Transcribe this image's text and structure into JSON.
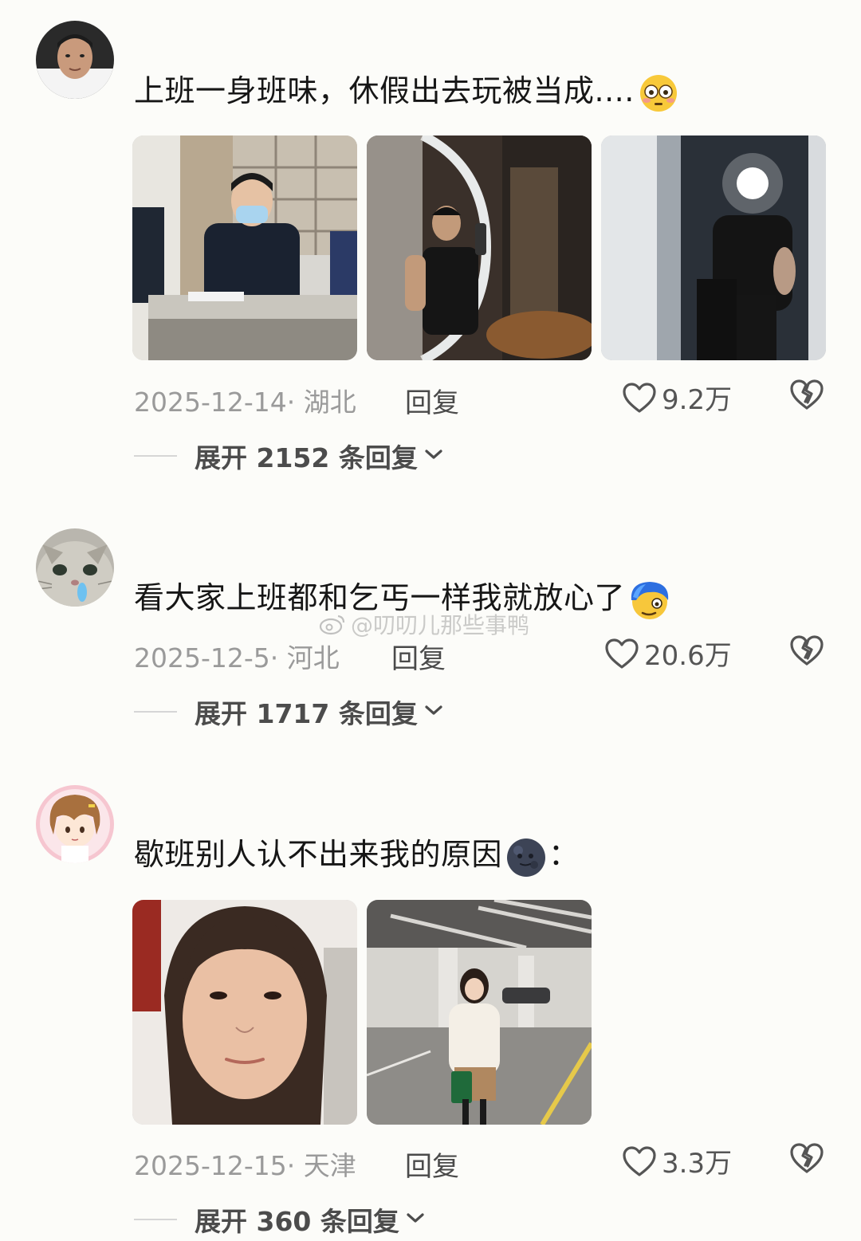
{
  "comments": [
    {
      "text": "上班一身班味，休假出去玩被当成....",
      "emoji": "flushed-face-emoji",
      "date": "2025-12-14·",
      "location": "湖北",
      "reply_label": "回复",
      "likes": "9.2万",
      "expand_label": "展开 2152 条回复"
    },
    {
      "text": "看大家上班都和乞丐一样我就放心了",
      "emoji": "blue-hair-face-emoji",
      "date": "2025-12-5·",
      "location": "河北",
      "reply_label": "回复",
      "likes": "20.6万",
      "expand_label": "展开 1717 条回复"
    },
    {
      "text": "歇班别人认不出来我的原因",
      "emoji": "new-moon-face-emoji",
      "text_suffix": "：",
      "date": "2025-12-15·",
      "location": "天津",
      "reply_label": "回复",
      "likes": "3.3万",
      "expand_label": "展开 360 条回复"
    }
  ],
  "watermark": "@叨叨儿那些事鸭",
  "colors": {
    "background": "#fcfcf9",
    "meta_text": "#9a9a9a",
    "expand_text": "#4c4c4c"
  }
}
